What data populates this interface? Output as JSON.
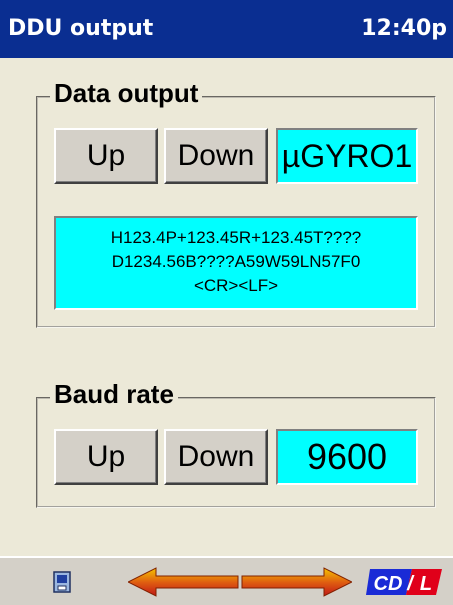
{
  "titlebar": {
    "title": "DDU output",
    "clock": "12:40p"
  },
  "data_output": {
    "label": "Data output",
    "up_label": "Up",
    "down_label": "Down",
    "value": "µGYRO1",
    "preview_lines": [
      "H123.4P+123.45R+123.45T????",
      "D1234.56B????A59W59LN57F0",
      "<CR><LF>"
    ]
  },
  "baud_rate": {
    "label": "Baud rate",
    "up_label": "Up",
    "down_label": "Down",
    "value": "9600"
  },
  "taskbar": {
    "logo_text": "CD/L",
    "icons": [
      "device-icon",
      "arrow-left-icon",
      "arrow-right-icon",
      "cdl-logo"
    ]
  },
  "colors": {
    "titlebar": "#0a2e91",
    "field": "#00ffff",
    "background": "#ece9d8",
    "logo_blue": "#1a2bd6",
    "logo_red": "#e0001a"
  }
}
